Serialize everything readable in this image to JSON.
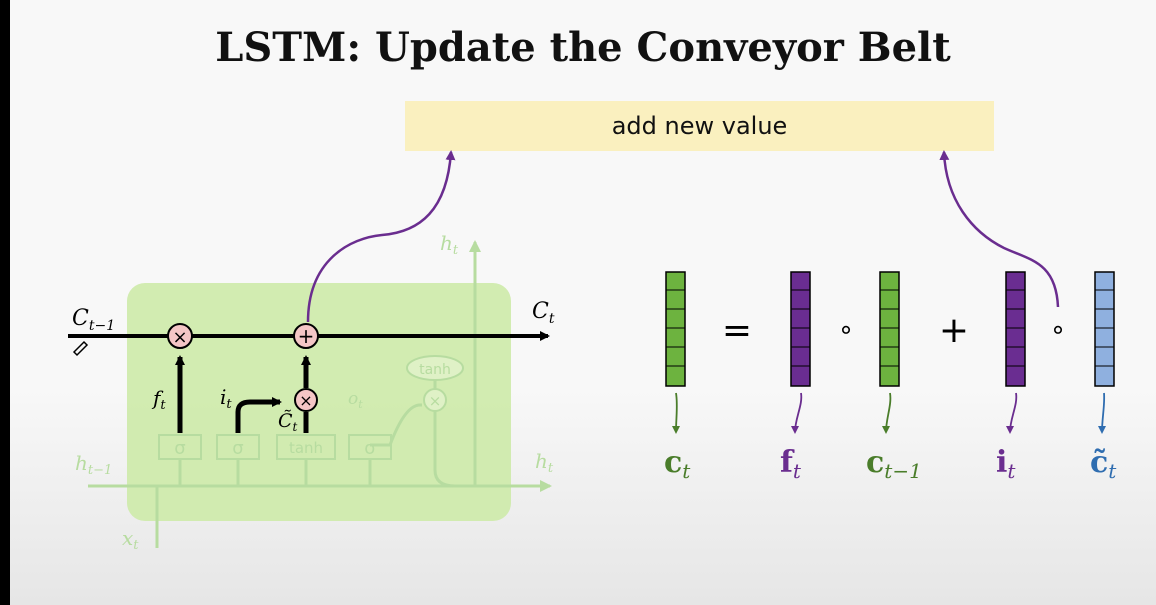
{
  "title": "LSTM: Update the Conveyor Belt",
  "banner_text": "add new value",
  "lstm": {
    "c_prev": "C",
    "c_prev_sub": "t−1",
    "c_out": "C",
    "c_out_sub": "t",
    "h_top": "h",
    "h_top_sub": "t",
    "h_prev": "h",
    "h_prev_sub": "t−1",
    "h_out": "h",
    "h_out_sub": "t",
    "x_in": "x",
    "x_in_sub": "t",
    "f": "f",
    "f_sub": "t",
    "i": "i",
    "i_sub": "t",
    "c_tilde": "C̃",
    "c_tilde_sub": "t",
    "o": "o",
    "o_sub": "t",
    "mul_symbol": "×",
    "add_symbol": "+",
    "gate_sigma": "σ",
    "gate_tanh": "tanh",
    "oval_tanh": "tanh"
  },
  "equation": {
    "equals": "=",
    "hadamard": "∘",
    "plus": "+",
    "labels": [
      {
        "symbol": "c",
        "sub": "t",
        "color": "#4a7d2a"
      },
      {
        "symbol": "f",
        "sub": "t",
        "color": "#6a2d8f"
      },
      {
        "symbol": "c",
        "sub": "t−1",
        "color": "#4a7d2a"
      },
      {
        "symbol": "i",
        "sub": "t",
        "color": "#6a2d8f"
      },
      {
        "symbol": "c̃",
        "sub": "t",
        "color": "#2f6db0"
      }
    ]
  },
  "colors": {
    "green_vector": "#6db33f",
    "purple_vector": "#6a2d91",
    "blue_vector": "#8fb0df",
    "arrow_purple": "#6a2d8f",
    "cell_fill": "#cdeaa8",
    "gate_pink": "#f4c6c6",
    "banner": "#faf0bf"
  }
}
